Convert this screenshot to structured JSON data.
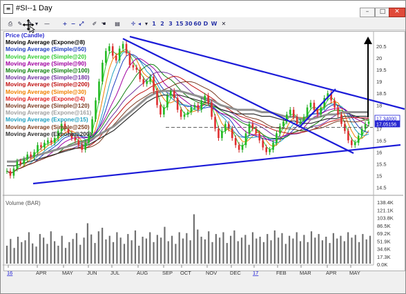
{
  "window": {
    "title": "#SI--1 Day",
    "app_icon": "chart-window-icon",
    "buttons": {
      "minimize": "–",
      "maximize": "□",
      "close": "✕"
    }
  },
  "toolbar": {
    "items": [
      "print-icon",
      "draw-icon",
      "move-icon",
      "dropdown-icon",
      "minus-icon",
      "plus-icon",
      "zoom-out-icon",
      "fit-icon",
      "pencil-icon",
      "hand-icon",
      "select-icon",
      "cross-icon",
      "left-icon",
      "dropdown-icon"
    ],
    "periods": [
      "1",
      "2",
      "3",
      "15",
      "30",
      "60",
      "D",
      "W"
    ],
    "close": "✕"
  },
  "legend": [
    {
      "label": "Price (Candle)",
      "color": "#2b2bd0"
    },
    {
      "label": "Moving Average (Expone@8)",
      "color": "#000000"
    },
    {
      "label": "Moving Average (Simple@50)",
      "color": "#2040c0"
    },
    {
      "label": "Moving Average (Simple@20)",
      "color": "#33cc33"
    },
    {
      "label": "Moving Average (Simple@90)",
      "color": "#a000a0"
    },
    {
      "label": "Moving Average (Simple@100)",
      "color": "#108010"
    },
    {
      "label": "Moving Average (Simple@180)",
      "color": "#7030a0"
    },
    {
      "label": "Moving Average (Simple@200)",
      "color": "#c01010"
    },
    {
      "label": "Moving Average (Simple@30)",
      "color": "#f08000"
    },
    {
      "label": "Moving Average (Expone@4)",
      "color": "#e02020"
    },
    {
      "label": "Moving Average (Simple@120)",
      "color": "#7a3a20"
    },
    {
      "label": "Moving Average (Expone@161)",
      "color": "#a0a0a0"
    },
    {
      "label": "Moving Average (Expone@15)",
      "color": "#20a0c0"
    },
    {
      "label": "Moving Average (Simple@250)",
      "color": "#804020"
    },
    {
      "label": "Moving Average (Expone@200)",
      "color": "#303030"
    }
  ],
  "volume_label": "Volume (BAR)",
  "chart_data": {
    "type": "line",
    "price_axis": [
      "20.5",
      "20",
      "19.5",
      "19",
      "18.5",
      "18",
      "17.5",
      "17",
      "16.5",
      "16",
      "15.5",
      "15",
      "14.5"
    ],
    "price_range": [
      14.4,
      21.0
    ],
    "last_price_labels": [
      "17.34000",
      "17.05156"
    ],
    "volume_axis": [
      "138.4K",
      "121.1K",
      "103.8K",
      "86.5K",
      "69.2K",
      "51.9K",
      "34.6K",
      "17.3K",
      "0.0K"
    ],
    "months": [
      "16",
      "APR",
      "MAY",
      "JUN",
      "JUL",
      "AUG",
      "SEP",
      "OCT",
      "NOV",
      "DEC",
      "17",
      "FEB",
      "MAR",
      "APR",
      "MAY"
    ],
    "price_series": [
      15.2,
      15.0,
      15.3,
      15.6,
      15.5,
      15.7,
      15.9,
      15.8,
      16.0,
      16.3,
      16.2,
      16.4,
      16.5,
      16.4,
      16.6,
      16.9,
      17.2,
      17.0,
      16.8,
      16.6,
      16.5,
      16.3,
      16.1,
      16.4,
      16.8,
      17.4,
      18.2,
      19.0,
      19.8,
      20.3,
      20.5,
      20.1,
      19.9,
      20.4,
      20.6,
      20.2,
      19.7,
      19.6,
      19.5,
      19.1,
      18.9,
      19.0,
      19.2,
      18.6,
      18.0,
      17.6,
      17.9,
      18.4,
      18.6,
      18.3,
      17.8,
      17.5,
      17.6,
      17.7,
      17.9,
      18.0,
      17.8,
      18.2,
      18.4,
      18.1,
      17.5,
      17.0,
      16.6,
      16.9,
      17.2,
      17.0,
      16.6,
      16.3,
      16.1,
      16.3,
      16.8,
      17.2,
      17.0,
      16.8,
      16.5,
      16.2,
      16.0,
      16.1,
      16.4,
      16.8,
      17.1,
      17.3,
      17.6,
      17.8,
      17.5,
      17.2,
      17.3,
      17.5,
      17.9,
      18.1,
      17.8,
      17.6,
      17.9,
      18.3,
      18.5,
      18.2,
      17.9,
      17.6,
      17.2,
      16.9,
      16.5,
      16.3,
      16.4,
      16.7,
      17.0,
      17.2,
      17.3
    ],
    "ma_slow": [
      15.6,
      15.6,
      15.7,
      15.8,
      15.9,
      16.0,
      16.1,
      16.2,
      16.3,
      16.4,
      16.5,
      16.7,
      16.9,
      17.1,
      17.4,
      17.7,
      18.0,
      18.3,
      18.5,
      18.6,
      18.6,
      18.6,
      18.5,
      18.4,
      18.3,
      18.2,
      18.0,
      17.9,
      17.8,
      17.8,
      17.8,
      17.7,
      17.7,
      17.6,
      17.5,
      17.5,
      17.4,
      17.4,
      17.5,
      17.6,
      17.6,
      17.7,
      17.7,
      17.7,
      17.7
    ],
    "volume": [
      40,
      55,
      35,
      60,
      48,
      52,
      70,
      45,
      38,
      66,
      58,
      44,
      72,
      50,
      40,
      62,
      35,
      48,
      55,
      68,
      42,
      58,
      90,
      65,
      46,
      72,
      80,
      54,
      62,
      48,
      70,
      58,
      44,
      66,
      52,
      74,
      40,
      60,
      56,
      70,
      48,
      64,
      58,
      82,
      50,
      62,
      44,
      70,
      56,
      68,
      52,
      110,
      76,
      60,
      54,
      72,
      48,
      66,
      58,
      70,
      46,
      62,
      74,
      50,
      58,
      64,
      42,
      70,
      56,
      60,
      48,
      66,
      52,
      74,
      58,
      68,
      44,
      62,
      56,
      70,
      50,
      64,
      48,
      72,
      58,
      66,
      52,
      60,
      46,
      68,
      56,
      62,
      50,
      70,
      58,
      64,
      48,
      66,
      54,
      62
    ]
  }
}
